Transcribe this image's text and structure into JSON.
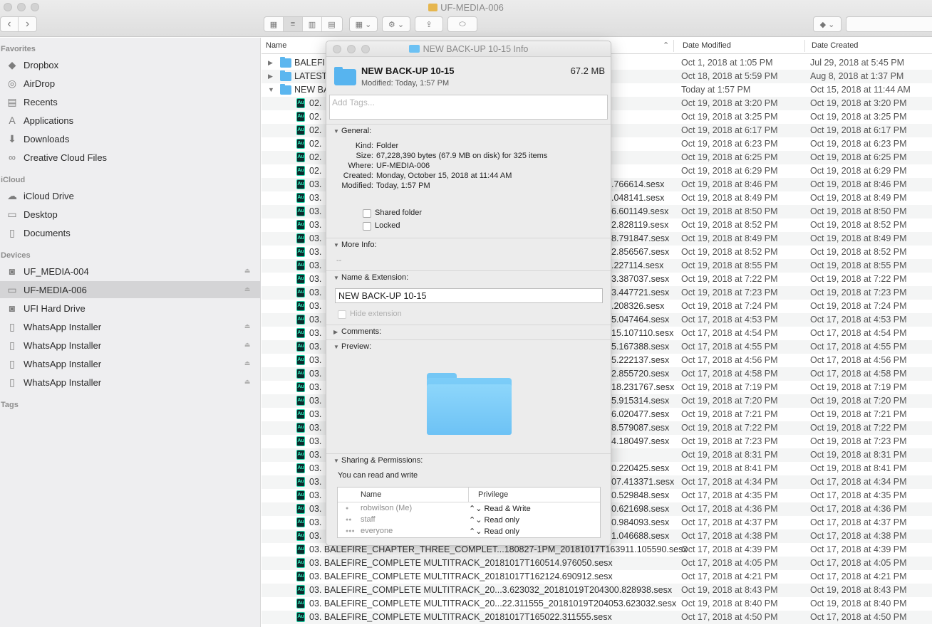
{
  "window": {
    "title": "UF-MEDIA-006"
  },
  "toolbar": {
    "back": "‹",
    "forward": "›",
    "view_icons": [
      "▦",
      "≡",
      "▥",
      "▤"
    ],
    "arrange": "▦ ⌄",
    "action": "⚙ ⌄",
    "share": "⇪",
    "tag": "⬭",
    "dropbox": "◆ ⌄"
  },
  "sidebar": {
    "favorites_heading": "Favorites",
    "favorites": [
      {
        "label": "Dropbox",
        "icon": "◆"
      },
      {
        "label": "AirDrop",
        "icon": "◎"
      },
      {
        "label": "Recents",
        "icon": "▤"
      },
      {
        "label": "Applications",
        "icon": "A"
      },
      {
        "label": "Downloads",
        "icon": "⬇"
      },
      {
        "label": "Creative Cloud Files",
        "icon": "∞"
      }
    ],
    "icloud_heading": "iCloud",
    "icloud": [
      {
        "label": "iCloud Drive",
        "icon": "☁"
      },
      {
        "label": "Desktop",
        "icon": "▭"
      },
      {
        "label": "Documents",
        "icon": "▯"
      }
    ],
    "devices_heading": "Devices",
    "devices": [
      {
        "label": "UF_MEDIA-004",
        "icon": "◙",
        "eject": true
      },
      {
        "label": "UF-MEDIA-006",
        "icon": "▭",
        "eject": true
      },
      {
        "label": "UFI Hard Drive",
        "icon": "◙",
        "eject": false
      },
      {
        "label": "WhatsApp Installer",
        "icon": "▯",
        "eject": true
      },
      {
        "label": "WhatsApp Installer",
        "icon": "▯",
        "eject": true
      },
      {
        "label": "WhatsApp Installer",
        "icon": "▯",
        "eject": true
      },
      {
        "label": "WhatsApp Installer",
        "icon": "▯",
        "eject": true
      }
    ],
    "tags_heading": "Tags",
    "eject_glyph": "⏏"
  },
  "list": {
    "columns": {
      "name": "Name",
      "date_modified": "Date Modified",
      "date_created": "Date Created",
      "sort_arrow": "⌃"
    },
    "rows": [
      {
        "kind": "folder",
        "disc": "▶",
        "name": "BALEFIR",
        "dm": "Oct 1, 2018 at 1:05 PM",
        "dc": "Jul 29, 2018 at 5:45 PM"
      },
      {
        "kind": "folder",
        "disc": "▶",
        "name": "LATEST",
        "dm": "Oct 18, 2018 at 5:59 PM",
        "dc": "Aug 8, 2018 at 1:37 PM"
      },
      {
        "kind": "folder",
        "disc": "▼",
        "name": "NEW BA",
        "dm": "Today at 1:57 PM",
        "dc": "Oct 15, 2018 at 11:44 AM"
      },
      {
        "kind": "au",
        "name": "02.",
        "dm": "Oct 19, 2018 at 3:20 PM",
        "dc": "Oct 19, 2018 at 3:20 PM"
      },
      {
        "kind": "au",
        "name": "02.",
        "dm": "Oct 19, 2018 at 3:25 PM",
        "dc": "Oct 19, 2018 at 3:25 PM"
      },
      {
        "kind": "au",
        "name": "02.",
        "dm": "Oct 19, 2018 at 6:17 PM",
        "dc": "Oct 19, 2018 at 6:17 PM"
      },
      {
        "kind": "au",
        "name": "02.",
        "dm": "Oct 19, 2018 at 6:23 PM",
        "dc": "Oct 19, 2018 at 6:23 PM"
      },
      {
        "kind": "au",
        "name": "02.",
        "dm": "Oct 19, 2018 at 6:25 PM",
        "dc": "Oct 19, 2018 at 6:25 PM"
      },
      {
        "kind": "au",
        "name": "02.",
        "dm": "Oct 19, 2018 at 6:29 PM",
        "dc": "Oct 19, 2018 at 6:29 PM"
      },
      {
        "kind": "au",
        "name": "03.",
        "tail": ".766614.sesx",
        "dm": "Oct 19, 2018 at 8:46 PM",
        "dc": "Oct 19, 2018 at 8:46 PM"
      },
      {
        "kind": "au",
        "name": "03.",
        "tail": ".048141.sesx",
        "dm": "Oct 19, 2018 at 8:49 PM",
        "dc": "Oct 19, 2018 at 8:49 PM"
      },
      {
        "kind": "au",
        "name": "03.",
        "tail": "6.601149.sesx",
        "dm": "Oct 19, 2018 at 8:50 PM",
        "dc": "Oct 19, 2018 at 8:50 PM"
      },
      {
        "kind": "au",
        "name": "03.",
        "tail": "2.828119.sesx",
        "dm": "Oct 19, 2018 at 8:52 PM",
        "dc": "Oct 19, 2018 at 8:52 PM"
      },
      {
        "kind": "au",
        "name": "03.",
        "tail": "8.791847.sesx",
        "dm": "Oct 19, 2018 at 8:49 PM",
        "dc": "Oct 19, 2018 at 8:49 PM"
      },
      {
        "kind": "au",
        "name": "03.",
        "tail": "2.856567.sesx",
        "dm": "Oct 19, 2018 at 8:52 PM",
        "dc": "Oct 19, 2018 at 8:52 PM"
      },
      {
        "kind": "au",
        "name": "03.",
        "tail": ".227114.sesx",
        "dm": "Oct 19, 2018 at 8:55 PM",
        "dc": "Oct 19, 2018 at 8:55 PM"
      },
      {
        "kind": "au",
        "name": "03.",
        "tail": "3.387037.sesx",
        "dm": "Oct 19, 2018 at 7:22 PM",
        "dc": "Oct 19, 2018 at 7:22 PM"
      },
      {
        "kind": "au",
        "name": "03.",
        "tail": "3.447721.sesx",
        "dm": "Oct 19, 2018 at 7:23 PM",
        "dc": "Oct 19, 2018 at 7:23 PM"
      },
      {
        "kind": "au",
        "name": "03.",
        "tail": ".208326.sesx",
        "dm": "Oct 19, 2018 at 7:24 PM",
        "dc": "Oct 19, 2018 at 7:24 PM"
      },
      {
        "kind": "au",
        "name": "03.",
        "tail": "5.047464.sesx",
        "dm": "Oct 17, 2018 at 4:53 PM",
        "dc": "Oct 17, 2018 at 4:53 PM"
      },
      {
        "kind": "au",
        "name": "03.",
        "tail": "15.107110.sesx",
        "dm": "Oct 17, 2018 at 4:54 PM",
        "dc": "Oct 17, 2018 at 4:54 PM"
      },
      {
        "kind": "au",
        "name": "03.",
        "tail": "5.167388.sesx",
        "dm": "Oct 17, 2018 at 4:55 PM",
        "dc": "Oct 17, 2018 at 4:55 PM"
      },
      {
        "kind": "au",
        "name": "03.",
        "tail": "5.222137.sesx",
        "dm": "Oct 17, 2018 at 4:56 PM",
        "dc": "Oct 17, 2018 at 4:56 PM"
      },
      {
        "kind": "au",
        "name": "03.",
        "tail": "2.855720.sesx",
        "dm": "Oct 17, 2018 at 4:58 PM",
        "dc": "Oct 17, 2018 at 4:58 PM"
      },
      {
        "kind": "au",
        "name": "03.",
        "tail": "18.231767.sesx",
        "dm": "Oct 19, 2018 at 7:19 PM",
        "dc": "Oct 19, 2018 at 7:19 PM"
      },
      {
        "kind": "au",
        "name": "03.",
        "tail": "5.915314.sesx",
        "dm": "Oct 19, 2018 at 7:20 PM",
        "dc": "Oct 19, 2018 at 7:20 PM"
      },
      {
        "kind": "au",
        "name": "03.",
        "tail": "6.020477.sesx",
        "dm": "Oct 19, 2018 at 7:21 PM",
        "dc": "Oct 19, 2018 at 7:21 PM"
      },
      {
        "kind": "au",
        "name": "03.",
        "tail": "8.579087.sesx",
        "dm": "Oct 19, 2018 at 7:22 PM",
        "dc": "Oct 19, 2018 at 7:22 PM"
      },
      {
        "kind": "au",
        "name": "03.",
        "tail": "4.180497.sesx",
        "dm": "Oct 19, 2018 at 7:23 PM",
        "dc": "Oct 19, 2018 at 7:23 PM"
      },
      {
        "kind": "au",
        "name": "03.",
        "dm": "Oct 19, 2018 at 8:31 PM",
        "dc": "Oct 19, 2018 at 8:31 PM"
      },
      {
        "kind": "au",
        "name": "03.",
        "tail": "0.220425.sesx",
        "dm": "Oct 19, 2018 at 8:41 PM",
        "dc": "Oct 19, 2018 at 8:41 PM"
      },
      {
        "kind": "au",
        "name": "03.",
        "tail": "07.413371.sesx",
        "dm": "Oct 17, 2018 at 4:34 PM",
        "dc": "Oct 17, 2018 at 4:34 PM"
      },
      {
        "kind": "au",
        "name": "03.",
        "tail": "0.529848.sesx",
        "dm": "Oct 17, 2018 at 4:35 PM",
        "dc": "Oct 17, 2018 at 4:35 PM"
      },
      {
        "kind": "au",
        "name": "03.",
        "tail": "0.621698.sesx",
        "dm": "Oct 17, 2018 at 4:36 PM",
        "dc": "Oct 17, 2018 at 4:36 PM"
      },
      {
        "kind": "au",
        "name": "03.",
        "tail": "0.984093.sesx",
        "dm": "Oct 17, 2018 at 4:37 PM",
        "dc": "Oct 17, 2018 at 4:37 PM"
      },
      {
        "kind": "au",
        "name": "03.",
        "tail": "1.046688.sesx",
        "dm": "Oct 17, 2018 at 4:38 PM",
        "dc": "Oct 17, 2018 at 4:38 PM"
      },
      {
        "kind": "au",
        "name": "03. BALEFIRE_CHAPTER_THREE_COMPLET...180827-1PM_20181017T163911.105590.sesx",
        "dm": "Oct 17, 2018 at 4:39 PM",
        "dc": "Oct 17, 2018 at 4:39 PM"
      },
      {
        "kind": "au",
        "name": "03. BALEFIRE_COMPLETE MULTITRACK_20181017T160514.976050.sesx",
        "dm": "Oct 17, 2018 at 4:05 PM",
        "dc": "Oct 17, 2018 at 4:05 PM"
      },
      {
        "kind": "au",
        "name": "03. BALEFIRE_COMPLETE MULTITRACK_20181017T162124.690912.sesx",
        "dm": "Oct 17, 2018 at 4:21 PM",
        "dc": "Oct 17, 2018 at 4:21 PM"
      },
      {
        "kind": "au",
        "name": "03. BALEFIRE_COMPLETE MULTITRACK_20...3.623032_20181019T204300.828938.sesx",
        "dm": "Oct 19, 2018 at 8:43 PM",
        "dc": "Oct 19, 2018 at 8:43 PM"
      },
      {
        "kind": "au",
        "name": "03. BALEFIRE_COMPLETE MULTITRACK_20...22.311555_20181019T204053.623032.sesx",
        "dm": "Oct 19, 2018 at 8:40 PM",
        "dc": "Oct 19, 2018 at 8:40 PM"
      },
      {
        "kind": "au",
        "name": "03. BALEFIRE_COMPLETE MULTITRACK_20181017T165022.311555.sesx",
        "dm": "Oct 17, 2018 at 4:50 PM",
        "dc": "Oct 17, 2018 at 4:50 PM"
      }
    ],
    "au_badge": "Au"
  },
  "info": {
    "window_title": "NEW BACK-UP 10-15 Info",
    "name": "NEW BACK-UP 10-15",
    "size": "67.2 MB",
    "modified": "Modified: Today, 1:57 PM",
    "tags_placeholder": "Add Tags...",
    "general": {
      "heading": "General:",
      "kind_k": "Kind:",
      "kind_v": "Folder",
      "size_k": "Size:",
      "size_v": "67,228,390 bytes (67.9 MB on disk) for 325 items",
      "where_k": "Where:",
      "where_v": "UF-MEDIA-006",
      "created_k": "Created:",
      "created_v": "Monday, October 15, 2018 at 11:44 AM",
      "modified_k": "Modified:",
      "modified_v": "Today, 1:57 PM",
      "shared": "Shared folder",
      "locked": "Locked"
    },
    "more_info": {
      "heading": "More Info:",
      "value": "--"
    },
    "name_ext": {
      "heading": "Name & Extension:",
      "value": "NEW BACK-UP 10-15",
      "hide": "Hide extension"
    },
    "comments": {
      "heading": "Comments:"
    },
    "preview": {
      "heading": "Preview:"
    },
    "sharing": {
      "heading": "Sharing & Permissions:",
      "summary": "You can read and write",
      "col_name": "Name",
      "col_priv": "Privilege",
      "rows": [
        {
          "user": "robwilson (Me)",
          "icon": "●",
          "priv": "⌃⌄ Read & Write"
        },
        {
          "user": "staff",
          "icon": "●●",
          "priv": "⌃⌄ Read only"
        },
        {
          "user": "everyone",
          "icon": "●●●",
          "priv": "⌃⌄ Read only"
        }
      ]
    }
  },
  "triangles": {
    "open": "▼",
    "closed": "▶"
  }
}
